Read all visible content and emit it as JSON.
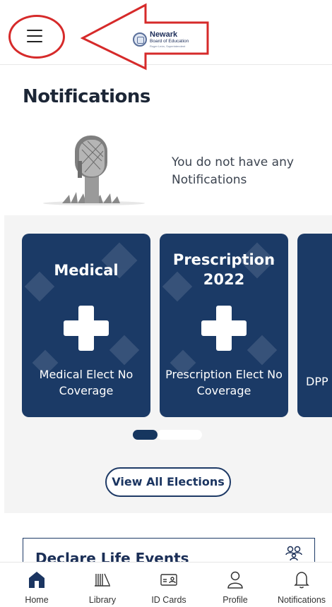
{
  "header": {
    "logo": {
      "line1": "Newark",
      "line2": "Board of Education",
      "line3": "Roger León, Superintendent"
    }
  },
  "page": {
    "title": "Notifications"
  },
  "empty_state": {
    "message": "You do not have any Notifications"
  },
  "elections": {
    "cards": [
      {
        "title": "Medical",
        "description": "Medical Elect No Coverage",
        "icon": "plus-icon"
      },
      {
        "title": "Prescription 2022",
        "description": "Prescription Elect No Coverage",
        "icon": "plus-icon"
      },
      {
        "title": "",
        "description": "DPP",
        "icon": ""
      }
    ],
    "pager": {
      "active_index": 0
    },
    "view_all_label": "View All Elections"
  },
  "life_events": {
    "title": "Declare Life Events",
    "icon": "people-icon"
  },
  "tabbar": {
    "items": [
      {
        "label": "Home",
        "icon": "home-icon",
        "active": true
      },
      {
        "label": "Library",
        "icon": "library-icon"
      },
      {
        "label": "ID Cards",
        "icon": "id-card-icon"
      },
      {
        "label": "Profile",
        "icon": "profile-icon"
      },
      {
        "label": "Notifications",
        "icon": "bell-icon"
      }
    ]
  },
  "colors": {
    "primary": "#1b3a66",
    "annotation": "#d62a2a",
    "band": "#f4f4f4"
  }
}
